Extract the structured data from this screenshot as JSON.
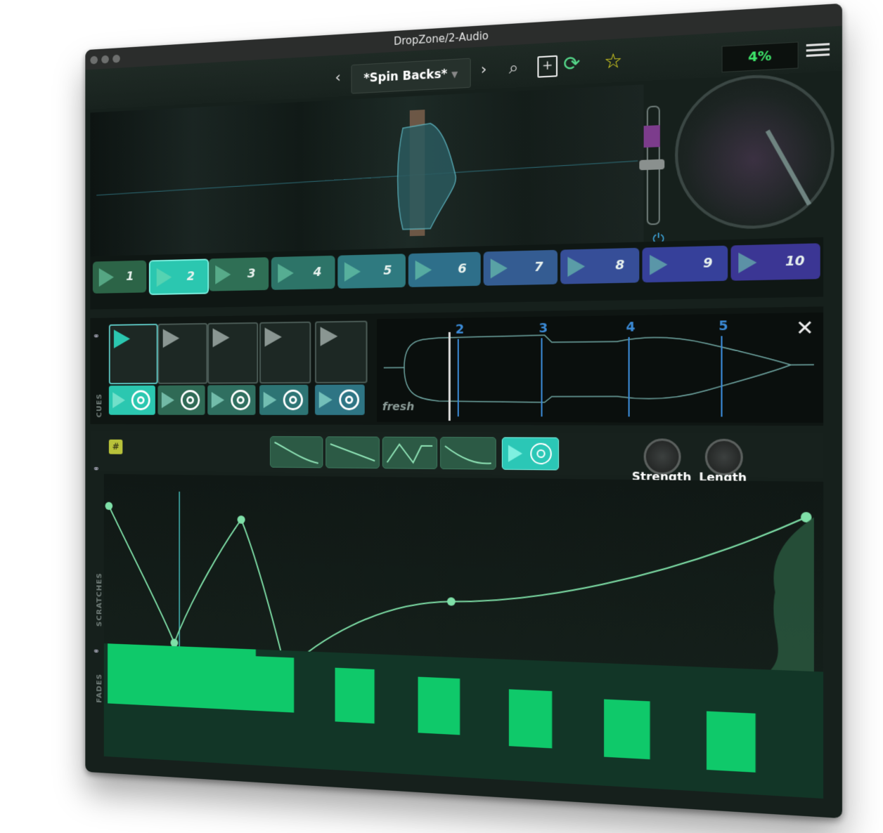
{
  "window": {
    "title": "DropZone/2-Audio"
  },
  "toolbar": {
    "preset_name": "*Spin Backs*",
    "prev_label": "‹",
    "next_label": "›",
    "cpu": "4%"
  },
  "pads": [
    "1",
    "2",
    "3",
    "4",
    "5",
    "6",
    "7",
    "8",
    "9",
    "10"
  ],
  "cues": {
    "side_label": "CUES",
    "wave_label": "fresh",
    "markers": [
      "2",
      "3",
      "4",
      "5"
    ],
    "close": "✕"
  },
  "scratches": {
    "side_label": "SCRATCHES",
    "strength_label": "Strength",
    "length_label": "Length"
  },
  "fades": {
    "side_label": "FADES"
  },
  "colors": {
    "accent": "#3ee0b0",
    "green": "#0fc96a",
    "cpu": "#3ee66a"
  }
}
